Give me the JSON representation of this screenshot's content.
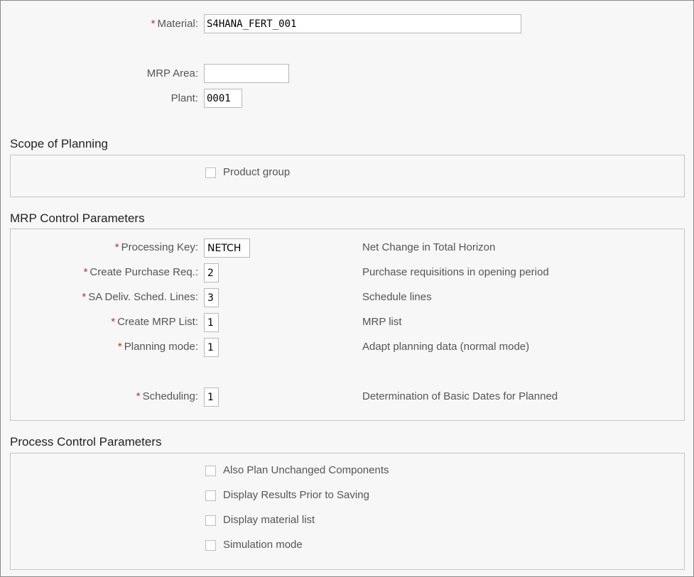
{
  "header": {
    "material_label": "Material:",
    "material_value": "S4HANA_FERT_001",
    "mrp_area_label": "MRP Area:",
    "mrp_area_value": "",
    "plant_label": "Plant:",
    "plant_value": "0001",
    "required_marker": "*"
  },
  "scope_of_planning": {
    "title": "Scope of Planning",
    "product_group_label": "Product group",
    "product_group_checked": false
  },
  "mrp_control": {
    "title": "MRP Control Parameters",
    "rows": [
      {
        "label": "Processing Key:",
        "value": "NETCH",
        "description": "Net Change in Total Horizon"
      },
      {
        "label": "Create Purchase Req.:",
        "value": "2",
        "description": "Purchase requisitions in opening period"
      },
      {
        "label": "SA Deliv. Sched. Lines:",
        "value": "3",
        "description": "Schedule lines"
      },
      {
        "label": "Create MRP List:",
        "value": "1",
        "description": "MRP list"
      },
      {
        "label": "Planning mode:",
        "value": "1",
        "description": "Adapt planning data (normal mode)"
      },
      {
        "label": "Scheduling:",
        "value": "1",
        "description": "Determination of Basic Dates for Planned"
      }
    ]
  },
  "process_control": {
    "title": "Process Control Parameters",
    "options": [
      {
        "label": "Also Plan Unchanged Components",
        "checked": false
      },
      {
        "label": "Display Results Prior to Saving",
        "checked": false
      },
      {
        "label": "Display material list",
        "checked": false
      },
      {
        "label": "Simulation mode",
        "checked": false
      }
    ]
  },
  "colors": {
    "required": "#d0271d",
    "background": "#f7f7f7",
    "border": "#c4c4c4"
  }
}
